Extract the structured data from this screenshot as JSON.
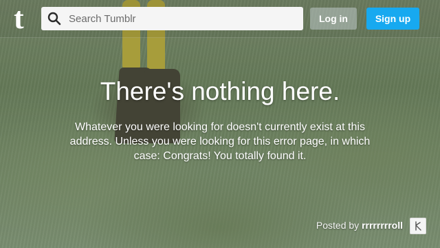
{
  "header": {
    "logo_text": "t",
    "search": {
      "placeholder": "Search Tumblr",
      "icon": "search-icon"
    },
    "login_label": "Log in",
    "signup_label": "Sign up"
  },
  "error": {
    "title": "There's nothing here.",
    "message": "Whatever you were looking for doesn't currently exist at this address. Unless you were looking for this error page, in which case: Congrats! You totally found it."
  },
  "credit": {
    "prefix": "Posted by",
    "username": "rrrrrrrroll",
    "avatar_icon": "user-avatar-icon"
  },
  "colors": {
    "signup": "#17a9f0",
    "text": "#ffffff"
  }
}
